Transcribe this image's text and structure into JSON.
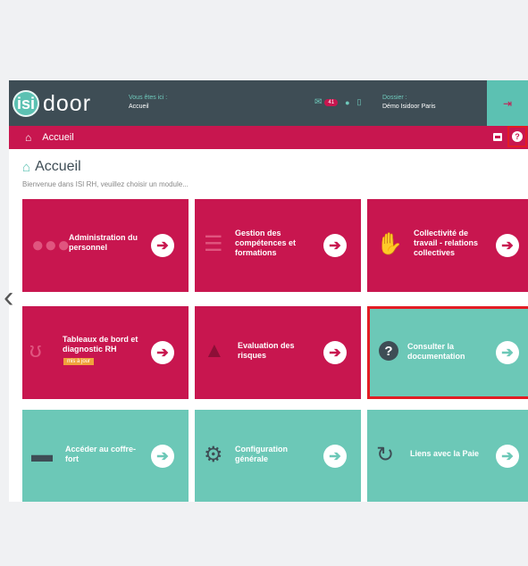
{
  "header": {
    "logo_text": "door",
    "logo_badge": "isi",
    "location_label": "Vous êtes ici :",
    "location_value": "Accueil",
    "message_count": "41",
    "dossier_label": "Dossier :",
    "dossier_value": "Démo Isidoor Paris",
    "logout_icon": "logout-icon"
  },
  "breadcrumb": {
    "label": "Accueil"
  },
  "page": {
    "title": "Accueil",
    "subtitle": "Bienvenue dans ISI RH, veuillez choisir un module..."
  },
  "tiles": [
    {
      "label": "Administration du personnel",
      "icon": "users-icon",
      "color": "#c8164f"
    },
    {
      "label": "Gestion des compétences et formations",
      "icon": "signpost-icon",
      "color": "#c8164f"
    },
    {
      "label": "Collectivité de travail - relations collectives",
      "icon": "handshake-icon",
      "color": "#c8164f"
    },
    {
      "label": "Tableaux de bord et diagnostic RH",
      "tag": "mis à jour",
      "icon": "stethoscope-icon",
      "color": "#c8164f"
    },
    {
      "label": "Evaluation des risques",
      "icon": "warning-icon",
      "color": "#c8164f"
    },
    {
      "label": "Consulter la documentation",
      "icon": "question-icon",
      "color": "#6cc8b7"
    },
    {
      "label": "Accéder au coffre-fort",
      "icon": "folder-icon",
      "color": "#6cc8b7"
    },
    {
      "label": "Configuration générale",
      "icon": "gear-icon",
      "color": "#6cc8b7"
    },
    {
      "label": "Liens avec la Paie",
      "icon": "refresh-icon",
      "color": "#6cc8b7"
    }
  ],
  "colors": {
    "primary": "#c8164f",
    "accent": "#6cc8b7",
    "header_bg": "#3e4d55",
    "highlight": "#e21c24"
  }
}
